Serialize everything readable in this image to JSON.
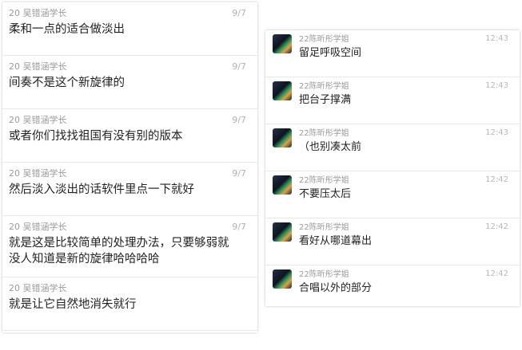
{
  "left_messages": [
    {
      "sender": "20 吴错涵学长",
      "time": "9/7",
      "text": "柔和一点的适合做淡出"
    },
    {
      "sender": "20 吴错涵学长",
      "time": "9/7",
      "text": "间奏不是这个新旋律的"
    },
    {
      "sender": "20 吴错涵学长",
      "time": "9/7",
      "text": "或者你们找找祖国有没有别的版本"
    },
    {
      "sender": "20 吴错涵学长",
      "time": "9/7",
      "text": "然后淡入淡出的话软件里点一下就好"
    },
    {
      "sender": "20 吴错涵学长",
      "time": "9/7",
      "text": "就是这是比较简单的处理办法，只要够弱就\n没人知道是新的旋律哈哈哈哈"
    },
    {
      "sender": "20 吴错涵学长",
      "time": "",
      "text": "就是让它自然地消失就行"
    }
  ],
  "right_messages": [
    {
      "sender": "22陈昕彤学姐",
      "time": "12:43",
      "text": "留足呼吸空间"
    },
    {
      "sender": "22陈昕彤学姐",
      "time": "12:43",
      "text": "把台子撑满"
    },
    {
      "sender": "22陈昕彤学姐",
      "time": "12:43",
      "text": "（也别凑太前"
    },
    {
      "sender": "22陈昕彤学姐",
      "time": "12:42",
      "text": "不要压太后"
    },
    {
      "sender": "22陈昕彤学姐",
      "time": "12:42",
      "text": "看好从哪道幕出"
    },
    {
      "sender": "22陈昕彤学姐",
      "time": "12:42",
      "text": "合唱以外的部分"
    }
  ]
}
